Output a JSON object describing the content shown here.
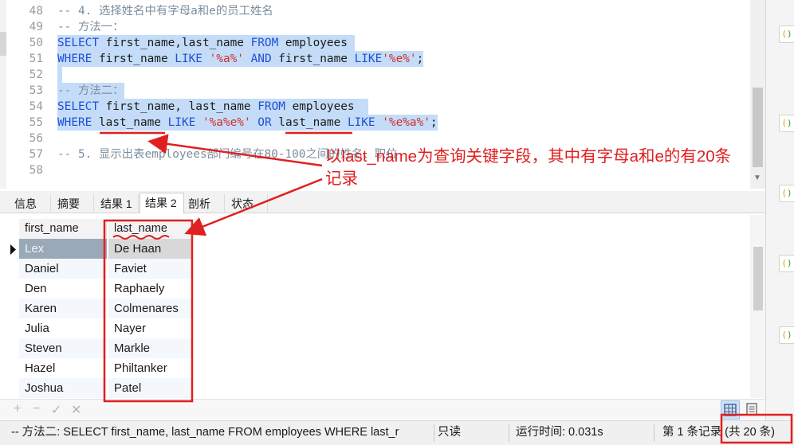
{
  "editor": {
    "lines": [
      {
        "n": "48",
        "parts": [
          {
            "t": "-- 4. 选择姓名中有字母a和e的员工姓名",
            "c": "cm"
          }
        ]
      },
      {
        "n": "49",
        "parts": [
          {
            "t": "-- 方法一：",
            "c": "cm"
          }
        ]
      },
      {
        "n": "50",
        "sel": true,
        "parts": [
          {
            "t": "SELECT",
            "c": "kw"
          },
          {
            "t": " first_name,last_name ",
            "c": "id"
          },
          {
            "t": "FROM",
            "c": "kw"
          },
          {
            "t": " employees ",
            "c": "id"
          }
        ]
      },
      {
        "n": "51",
        "sel": true,
        "parts": [
          {
            "t": "WHERE",
            "c": "kw"
          },
          {
            "t": " first_name ",
            "c": "id"
          },
          {
            "t": "LIKE",
            "c": "kw"
          },
          {
            "t": " ",
            "c": "id"
          },
          {
            "t": "'%a%'",
            "c": "str"
          },
          {
            "t": " ",
            "c": "id"
          },
          {
            "t": "AND",
            "c": "kw"
          },
          {
            "t": " first_name ",
            "c": "id"
          },
          {
            "t": "LIKE",
            "c": "kw"
          },
          {
            "t": "'%e%'",
            "c": "str"
          },
          {
            "t": ";",
            "c": "id"
          }
        ]
      },
      {
        "n": "52",
        "sel": true,
        "parts": [
          {
            "t": "",
            "c": "id"
          }
        ]
      },
      {
        "n": "53",
        "sel": true,
        "parts": [
          {
            "t": "-- 方法二：",
            "c": "cm"
          }
        ]
      },
      {
        "n": "54",
        "sel": true,
        "parts": [
          {
            "t": "SELECT",
            "c": "kw"
          },
          {
            "t": " first_name, last_name ",
            "c": "id"
          },
          {
            "t": "FROM",
            "c": "kw"
          },
          {
            "t": " employees  ",
            "c": "id"
          }
        ]
      },
      {
        "n": "55",
        "sel": true,
        "parts": [
          {
            "t": "WHERE",
            "c": "kw"
          },
          {
            "t": " last_name ",
            "c": "id"
          },
          {
            "t": "LIKE",
            "c": "kw"
          },
          {
            "t": " ",
            "c": "id"
          },
          {
            "t": "'%a%e%'",
            "c": "str"
          },
          {
            "t": " ",
            "c": "id"
          },
          {
            "t": "OR",
            "c": "kw"
          },
          {
            "t": " last_name ",
            "c": "id"
          },
          {
            "t": "LIKE",
            "c": "kw"
          },
          {
            "t": " ",
            "c": "id"
          },
          {
            "t": "'%e%a%'",
            "c": "str"
          },
          {
            "t": ";",
            "c": "id"
          }
        ]
      },
      {
        "n": "56",
        "parts": [
          {
            "t": "",
            "c": "id"
          }
        ]
      },
      {
        "n": "57",
        "parts": [
          {
            "t": "-- 5. 显示出表employees部门编号在80-100之间的姓名、职位",
            "c": "cm"
          }
        ]
      },
      {
        "n": "58",
        "parts": [
          {
            "t": "",
            "c": "id"
          }
        ]
      }
    ]
  },
  "tabs": [
    {
      "label": "信息"
    },
    {
      "label": "摘要"
    },
    {
      "label": "结果 1"
    },
    {
      "label": "结果 2",
      "active": true
    },
    {
      "label": "剖析"
    },
    {
      "label": "状态"
    }
  ],
  "grid": {
    "columns": [
      "first_name",
      "last_name"
    ],
    "rows": [
      [
        "Lex",
        "De Haan"
      ],
      [
        "Daniel",
        "Faviet"
      ],
      [
        "Den",
        "Raphaely"
      ],
      [
        "Karen",
        "Colmenares"
      ],
      [
        "Julia",
        "Nayer"
      ],
      [
        "Steven",
        "Markle"
      ],
      [
        "Hazel",
        "Philtanker"
      ],
      [
        "Joshua",
        "Patel"
      ]
    ]
  },
  "gridbar": {
    "add": "+",
    "remove": "−",
    "apply": "✓",
    "discard": "✕"
  },
  "status": {
    "query": "-- 方法二:  SELECT first_name, last_name FROM employees  WHERE last_r",
    "mode": "只读",
    "runtime": "运行时间: 0.031s",
    "records": "第 1 条记录 (共 20 条)"
  },
  "annotation": {
    "line1": "以last_name为查询关键字段，其中有字母a和e的有20条",
    "line2": "记录"
  },
  "colors": {
    "annotation": "#e02020",
    "selection": "#c4dcf7",
    "keyword": "#1f4fd8",
    "string": "#d32f2f",
    "comment": "#7b8e9d"
  }
}
